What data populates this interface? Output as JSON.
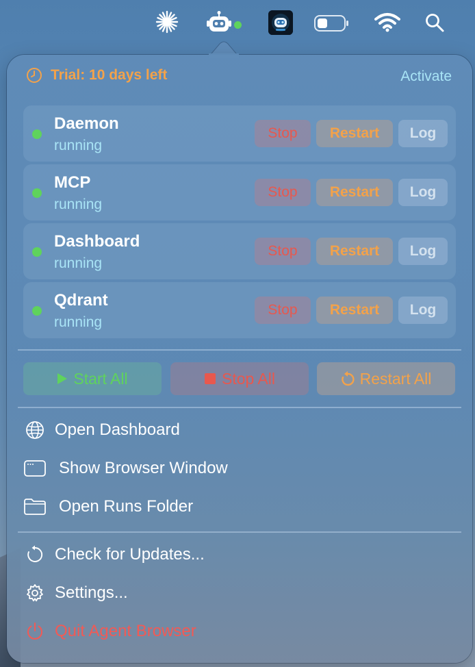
{
  "menubar": {
    "icons": [
      "asterisk-spark-icon",
      "robot-icon",
      "avatar-icon",
      "battery-icon",
      "wifi-icon",
      "search-icon"
    ],
    "status_color": "#5fd35c"
  },
  "trial": {
    "label": "Trial: 10 days left",
    "activate_label": "Activate"
  },
  "services": [
    {
      "name": "Daemon",
      "status": "running",
      "stop": "Stop",
      "restart": "Restart",
      "log": "Log"
    },
    {
      "name": "MCP",
      "status": "running",
      "stop": "Stop",
      "restart": "Restart",
      "log": "Log"
    },
    {
      "name": "Dashboard",
      "status": "running",
      "stop": "Stop",
      "restart": "Restart",
      "log": "Log"
    },
    {
      "name": "Qdrant",
      "status": "running",
      "stop": "Stop",
      "restart": "Restart",
      "log": "Log"
    }
  ],
  "bulk": {
    "start_all": "Start All",
    "stop_all": "Stop All",
    "restart_all": "Restart All"
  },
  "menu": {
    "open_dashboard": "Open Dashboard",
    "show_browser_window": "Show Browser Window",
    "open_runs_folder": "Open Runs Folder",
    "check_updates": "Check for Updates...",
    "settings": "Settings...",
    "quit": "Quit Agent Browser"
  },
  "colors": {
    "running": "#5fd35c",
    "stop": "#e8584e",
    "restart": "#f3a24a",
    "activate": "#a9e4f6",
    "quit": "#f25a55"
  }
}
